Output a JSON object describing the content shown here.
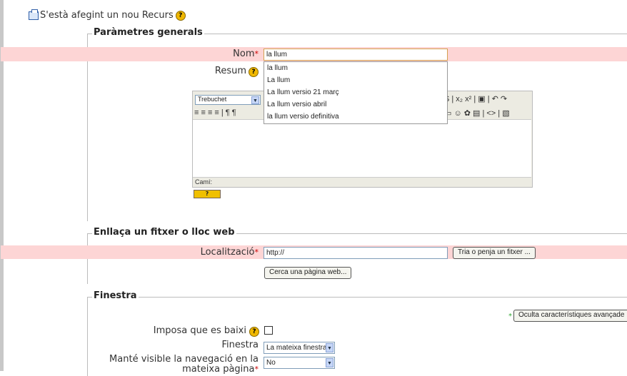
{
  "page": {
    "title": "S'està afegint un nou Recurs"
  },
  "general": {
    "legend": "Paràmetres generals",
    "name_label": "Nom",
    "required_mark": "*",
    "name_value": "la llum",
    "autocomplete": [
      "la llum",
      "La llum",
      "La llum versio 21 març",
      "La llum versio abril",
      "la llum versio definitiva"
    ],
    "summary_label": "Resum",
    "editor": {
      "font": "Trebuchet",
      "path_label": "Camí:"
    }
  },
  "link": {
    "legend": "Enllaça un fitxer o lloc web",
    "location_label": "Localització",
    "location_value": "http://",
    "choose_button": "Tria o penja un fitxer ...",
    "search_button": "Cerca una pàgina web..."
  },
  "window": {
    "legend": "Finestra",
    "advanced_button": "Oculta característiques avançade",
    "force_download_label": "Imposa que es baixi",
    "window_label": "Finestra",
    "window_value": "La mateixa finestra",
    "nav_label_1": "Manté visible la navegació en la",
    "nav_label_2": "mateixa pàgina",
    "nav_value": "No"
  },
  "colors": {
    "required_bg": "#fdd5d5",
    "accent": "#2f5ea8"
  }
}
